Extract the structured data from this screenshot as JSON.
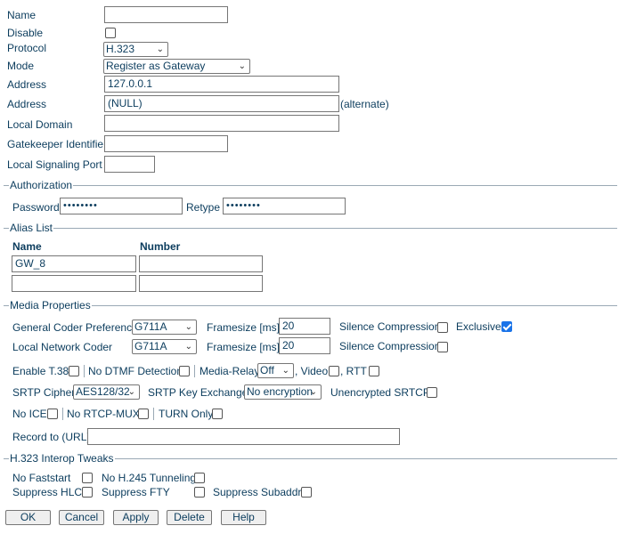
{
  "general": {
    "name_label": "Name",
    "name_value": "",
    "disable_label": "Disable",
    "protocol_label": "Protocol",
    "protocol_value": "H.323",
    "mode_label": "Mode",
    "mode_value": "Register as Gateway",
    "address_label": "Address",
    "address_value": "127.0.0.1",
    "address2_label": "Address",
    "address2_value": "(NULL)",
    "alternate_label": "(alternate)",
    "local_domain_label": "Local Domain",
    "gatekeeper_label": "Gatekeeper Identifier",
    "signaling_port_label": "Local Signaling Port"
  },
  "authorization": {
    "title": "Authorization",
    "password_label": "Password",
    "password_value": "••••••••",
    "retype_label": "Retype",
    "retype_value": "••••••••"
  },
  "alias_list": {
    "title": "Alias List",
    "name_header": "Name",
    "number_header": "Number",
    "rows": [
      {
        "name": "GW_8",
        "number": ""
      },
      {
        "name": "",
        "number": ""
      }
    ]
  },
  "media": {
    "title": "Media Properties",
    "general_coder_label": "General Coder Preference",
    "general_coder_value": "G711A",
    "framesize_label": "Framesize [ms]",
    "framesize1_value": "20",
    "silence_label": "Silence Compression",
    "exclusive_label": "Exclusive",
    "local_coder_label": "Local Network Coder",
    "local_coder_value": "G711A",
    "framesize2_value": "20",
    "enable_t38_label": "Enable T.38",
    "no_dtmf_label": "No DTMF Detection",
    "media_relay_label": "Media-Relay",
    "media_relay_value": "Off",
    "video_label": ", Video",
    "rtt_label": ", RTT",
    "srtp_cipher_label": "SRTP Cipher",
    "srtp_cipher_value": "AES128/32",
    "srtp_key_label": "SRTP Key Exchange",
    "srtp_key_value": "No encryption",
    "unencrypted_srtcp_label": "Unencrypted SRTCP",
    "no_ice_label": "No ICE",
    "no_rtcp_mux_label": "No RTCP-MUX",
    "turn_only_label": "TURN Only",
    "record_label": "Record to (URL)"
  },
  "interop": {
    "title": "H.323 Interop Tweaks",
    "no_faststart_label": "No Faststart",
    "no_h245_label": "No H.245 Tunneling",
    "suppress_hlc_label": "Suppress HLC",
    "suppress_fty_label": "Suppress FTY",
    "suppress_subaddr_label": "Suppress Subaddr"
  },
  "buttons": {
    "ok": "OK",
    "cancel": "Cancel",
    "apply": "Apply",
    "delete": "Delete",
    "help": "Help"
  },
  "colors": {
    "text": "#0b3c5d",
    "checkbox_checked": "#1a73e8"
  }
}
